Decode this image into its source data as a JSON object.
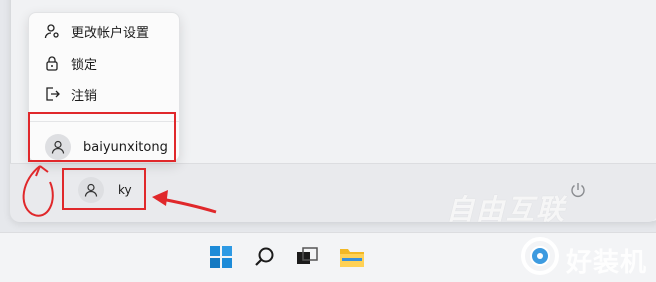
{
  "user_menu": {
    "items": [
      {
        "label": "更改帐户设置",
        "icon": "account-settings-icon"
      },
      {
        "label": "锁定",
        "icon": "lock-icon"
      },
      {
        "label": "注销",
        "icon": "sign-out-icon"
      }
    ],
    "other_account": {
      "name": "baiyunxitong",
      "icon": "user-avatar-icon"
    }
  },
  "current_user": {
    "name": "ky",
    "icon": "user-avatar-icon"
  },
  "power": {
    "icon": "power-icon"
  },
  "taskbar": {
    "icons": [
      "windows-start-icon",
      "search-icon",
      "task-view-icon",
      "file-explorer-icon"
    ]
  },
  "annotations": {
    "color": "#e0282b"
  },
  "watermarks": {
    "line1": "自由互联",
    "line2": "好装机"
  }
}
